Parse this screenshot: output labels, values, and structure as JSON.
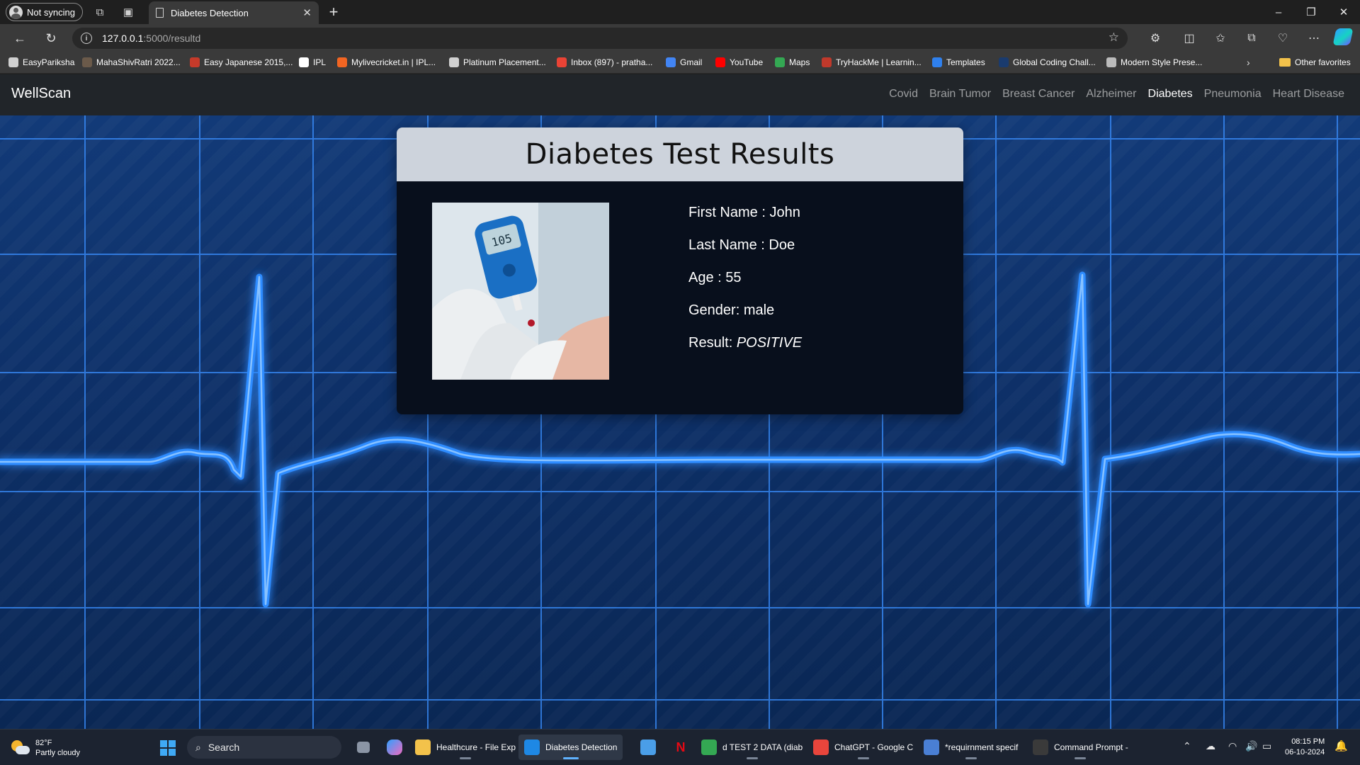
{
  "browser": {
    "profile_label": "Not syncing",
    "tab_title": "Diabetes Detection",
    "url_host": "127.0.0.1",
    "url_path": ":5000/resultd",
    "bookmarks": [
      {
        "label": "EasyPariksha",
        "icon_color": "#d0d0d0"
      },
      {
        "label": "MahaShivRatri 2022...",
        "icon_color": "#6b5a4a"
      },
      {
        "label": "Easy Japanese 2015,...",
        "icon_color": "#c53a2a"
      },
      {
        "label": "IPL",
        "icon_color": "#ffffff"
      },
      {
        "label": "Mylivecricket.in | IPL...",
        "icon_color": "#f26522"
      },
      {
        "label": "Platinum Placement...",
        "icon_color": "#d0d0d0"
      },
      {
        "label": "Inbox (897) - pratha...",
        "icon_color": "#ea4335"
      },
      {
        "label": "Gmail",
        "icon_color": "#4285f4"
      },
      {
        "label": "YouTube",
        "icon_color": "#ff0000"
      },
      {
        "label": "Maps",
        "icon_color": "#34a853"
      },
      {
        "label": "TryHackMe | Learnin...",
        "icon_color": "#c0392b"
      },
      {
        "label": "Templates",
        "icon_color": "#2f80ed"
      },
      {
        "label": "Global Coding Chall...",
        "icon_color": "#1a3b6e"
      },
      {
        "label": "Modern Style Prese...",
        "icon_color": "#bbbbbb"
      }
    ],
    "other_favorites": "Other favorites"
  },
  "site": {
    "brand": "WellScan",
    "nav": [
      "Covid",
      "Brain Tumor",
      "Breast Cancer",
      "Alzheimer",
      "Diabetes",
      "Pneumonia",
      "Heart Disease"
    ],
    "active_nav": "Diabetes"
  },
  "card": {
    "title": "Diabetes Test Results",
    "photo_reading": "105",
    "first_name": "First Name : John",
    "last_name": "Last Name : Doe",
    "age": "Age : 55",
    "gender": "Gender: male",
    "result_label": "Result: ",
    "result_value": "POSITIVE"
  },
  "taskbar": {
    "temperature": "82°F",
    "condition": "Partly cloudy",
    "search_placeholder": "Search",
    "apps": [
      {
        "label": "Healthcure - File Exp",
        "icon_color": "#f3c24b",
        "active": false
      },
      {
        "label": "Diabetes Detection",
        "icon_color": "#1e88e5",
        "active": true
      },
      {
        "label": "d TEST 2 DATA (diab",
        "icon_color": "#34a853",
        "active": false
      },
      {
        "label": "ChatGPT - Google C",
        "icon_color": "#e8453c",
        "active": false
      },
      {
        "label": "*requirnment specif",
        "icon_color": "#4a7fd4",
        "active": false
      },
      {
        "label": "Command Prompt -",
        "icon_color": "#3a3a3a",
        "active": false
      }
    ],
    "time": "08:15 PM",
    "date": "06-10-2024"
  },
  "colors": {
    "page_bg": "#0c2a5c",
    "grid_line": "#3a8fff",
    "ecg_line": "#2f8cff",
    "navbar_bg": "#212529",
    "card_bg": "#080f1c",
    "card_header_bg": "#cdd3dc"
  }
}
